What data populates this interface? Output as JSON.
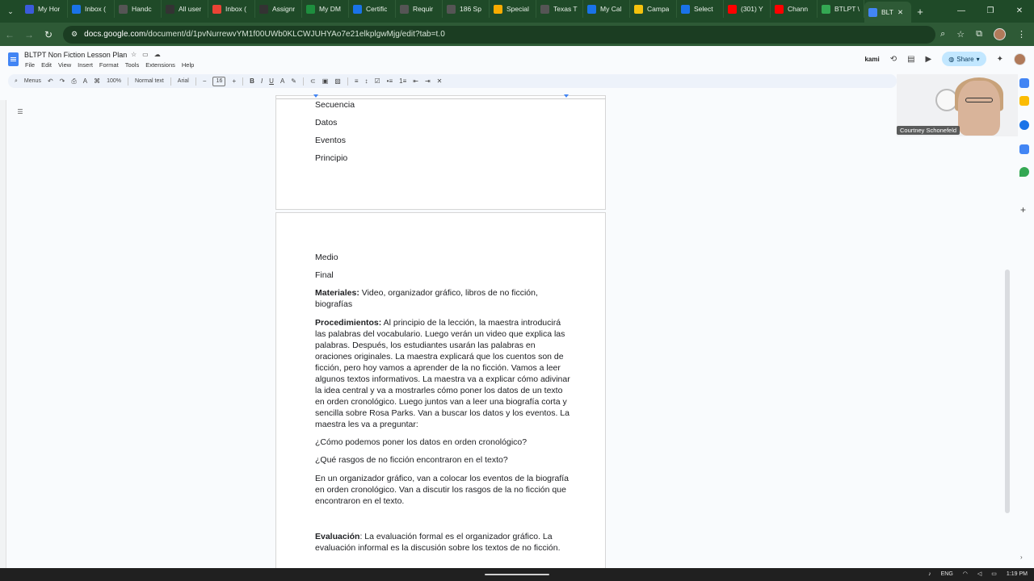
{
  "browser": {
    "tabs": [
      {
        "title": "My Hor",
        "color": "#3b5bdb",
        "icon": "wordpress-icon"
      },
      {
        "title": "Inbox (",
        "color": "#1a73e8",
        "icon": "mail-icon"
      },
      {
        "title": "Handc",
        "color": "#555555",
        "icon": "globe-icon"
      },
      {
        "title": "All user",
        "color": "#333333",
        "icon": "app-icon"
      },
      {
        "title": "Inbox (",
        "color": "#ea4335",
        "icon": "gmail-icon"
      },
      {
        "title": "Assignr",
        "color": "#333333",
        "icon": "app-icon"
      },
      {
        "title": "My DM",
        "color": "#1e8e3e",
        "icon": "add-icon"
      },
      {
        "title": "Certific",
        "color": "#1a73e8",
        "icon": "doc-icon"
      },
      {
        "title": "Requir",
        "color": "#555555",
        "icon": "globe-icon"
      },
      {
        "title": "186 Sp",
        "color": "#555555",
        "icon": "globe-icon"
      },
      {
        "title": "Special",
        "color": "#f9ab00",
        "icon": "slides-icon"
      },
      {
        "title": "Texas T",
        "color": "#555555",
        "icon": "doc-icon"
      },
      {
        "title": "My Cal",
        "color": "#1a73e8",
        "icon": "globe-icon"
      },
      {
        "title": "Campa",
        "color": "#f4c20d",
        "icon": "app-icon"
      },
      {
        "title": "Select",
        "color": "#1a73e8",
        "icon": "globe-icon"
      },
      {
        "title": "(301) Y",
        "color": "#ff0000",
        "icon": "youtube-icon"
      },
      {
        "title": "Chann",
        "color": "#ff0000",
        "icon": "youtube-icon"
      },
      {
        "title": "BTLPT \\",
        "color": "#34a853",
        "icon": "drive-icon"
      },
      {
        "title": "BLT",
        "color": "#4285f4",
        "icon": "docs-icon"
      }
    ],
    "url_host": "docs.google.com",
    "url_path": "/document/d/1pvNurrewvYM1f00UWb0KLCWJUHYAo7e21elkplgwMjg/edit?tab=t.0"
  },
  "doc": {
    "title": "BLTPT Non Fiction Lesson Plan",
    "menu": [
      "File",
      "Edit",
      "View",
      "Insert",
      "Format",
      "Tools",
      "Extensions",
      "Help"
    ],
    "share_label": "Share",
    "kami_label": "kami"
  },
  "toolbar": {
    "menus": "Menus",
    "zoom": "100%",
    "style": "Normal text",
    "font": "Arial",
    "font_size": "16"
  },
  "page1": {
    "lines": [
      "Secuencia",
      "Datos",
      "Eventos",
      "Principio"
    ]
  },
  "page2": {
    "medio": "Medio",
    "final": "Final",
    "materiales_label": "Materiales:",
    "materiales_text": "  Video, organizador gráfico, libros de no ficción, biografías",
    "proc_label": "Procedimientos:",
    "proc_text": " Al principio de la lección, la maestra introducirá las palabras del vocabulario.  Luego verán un video que explica las palabras.  Después, los estudiantes usarán las palabras en oraciones originales.  La maestra explicará que los cuentos son de ficción, pero hoy vamos a aprender de la no ficción.  Vamos a leer algunos textos informativos.  La maestra va a explicar cómo adivinar la idea central y va a mostrarles cómo poner los datos de un texto en orden cronológico.  Luego juntos van a leer una biografía corta y sencilla sobre Rosa Parks.  Van a buscar los datos y los eventos. La maestra les va a preguntar:",
    "q1": "¿Cómo podemos poner los datos en orden cronológico?",
    "q2": "¿Qué rasgos de no ficción encontraron en el texto?",
    "organizer": " En un organizador gráfico, van a colocar los eventos de la biografía en orden cronológico.  Van a discutir los rasgos de la no ficción que encontraron en el texto.",
    "eval_label": "Evaluación",
    "eval_text": ":  La evaluación formal es el organizador gráfico.  La evaluación informal es la discusión sobre los textos de no ficción."
  },
  "video": {
    "presenter": "Courtney Schonefeld"
  },
  "taskbar": {
    "lang": "ENG",
    "time": "1:19 PM"
  }
}
